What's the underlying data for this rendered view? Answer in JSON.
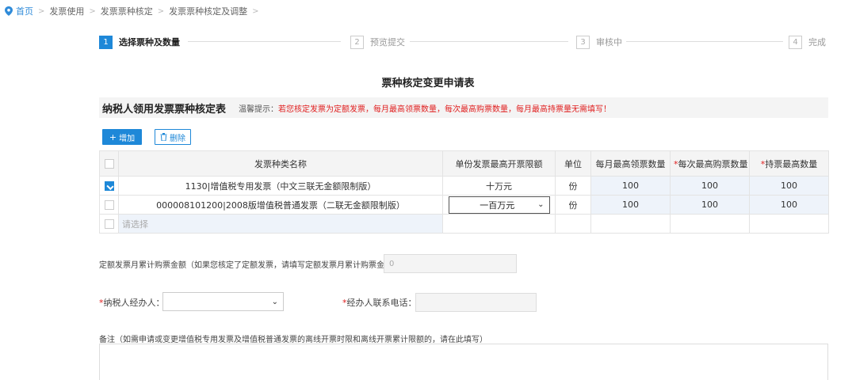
{
  "breadcrumb": {
    "items": [
      "首页",
      "发票使用",
      "发票票种核定",
      "发票票种核定及调整"
    ],
    "separator": ">"
  },
  "steps": [
    {
      "num": "1",
      "label": "选择票种及数量",
      "active": true
    },
    {
      "num": "2",
      "label": "预览提交",
      "active": false
    },
    {
      "num": "3",
      "label": "审核中",
      "active": false
    },
    {
      "num": "4",
      "label": "完成",
      "active": false
    }
  ],
  "form": {
    "title": "票种核定变更申请表",
    "section_title": "纳税人领用发票票种核定表",
    "tip_label": "温馨提示：",
    "tip_text": "若您核定发票为定额发票，每月最高领票数量，每次最高购票数量，每月最高持票量无需填写！"
  },
  "actions": {
    "add_label": "增加",
    "delete_label": "删除"
  },
  "table": {
    "headers": {
      "name": "发票种类名称",
      "limit": "单份发票最高开票限额",
      "unit": "单位",
      "monthly_max": "每月最高领票数量",
      "per_time_max": "每次最高购票数量",
      "hold_max": "持票最高数量",
      "required_mark": "*"
    },
    "rows": [
      {
        "checked": true,
        "name": "1130|增值税专用发票（中文三联无金额限制版）",
        "limit": "十万元",
        "unit": "份",
        "monthly_max": "100",
        "per_time_max": "100",
        "hold_max": "100"
      },
      {
        "checked": false,
        "name": "000008101200|2008版增值税普通发票（二联无金额限制版）",
        "limit": "一百万元",
        "unit": "份",
        "monthly_max": "100",
        "per_time_max": "100",
        "hold_max": "100"
      }
    ],
    "new_row_placeholder": "请选择"
  },
  "quota": {
    "label": "定额发票月累计购票金额（如果您核定了定额发票，请填写定额发票月累计购票金额）：",
    "value": "0"
  },
  "agent": {
    "required_mark": "*",
    "label": "纳税人经办人：",
    "value": "",
    "phone_label": "经办人联系电话：",
    "phone_value": ""
  },
  "remark": {
    "label": "备注（如需申请或变更增值税专用发票及增值税普通发票的离线开票时限和离线开票累计限额的，请在此填写）",
    "value": ""
  },
  "colors": {
    "accent": "#1e88d8",
    "required": "#e02020",
    "header_bg": "#f4f4f4",
    "highlight_cell": "#eef3fa"
  }
}
